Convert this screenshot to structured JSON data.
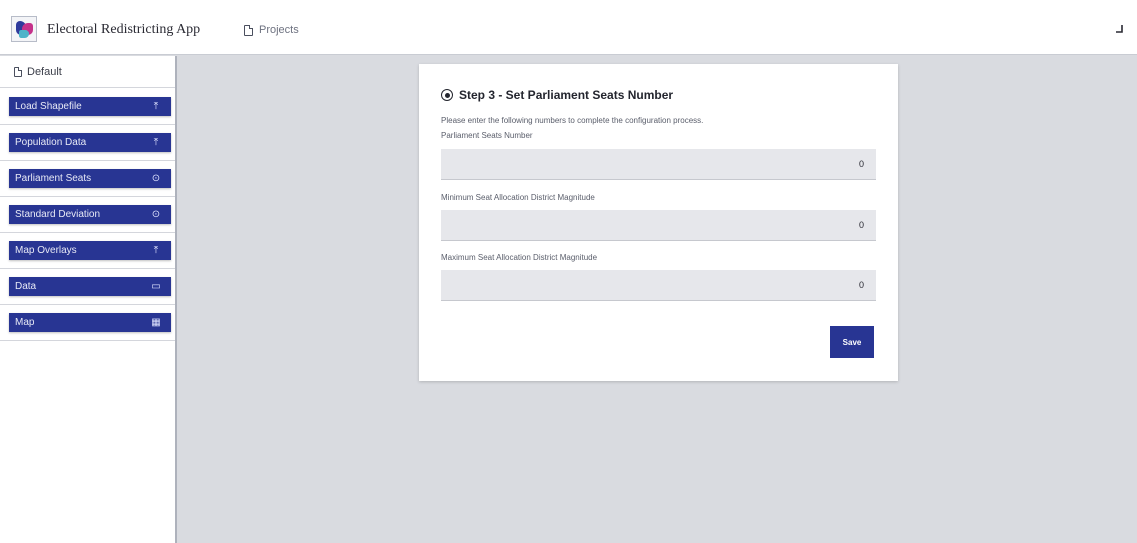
{
  "header": {
    "app_title": "Electoral Redistricting App",
    "projects_label": "Projects"
  },
  "sidebar": {
    "default_label": "Default",
    "items": [
      {
        "label": "Load Shapefile",
        "icon": "upload-icon"
      },
      {
        "label": "Population Data",
        "icon": "upload-icon"
      },
      {
        "label": "Parliament Seats",
        "icon": "radio-icon"
      },
      {
        "label": "Standard Deviation",
        "icon": "radio-icon"
      },
      {
        "label": "Map Overlays",
        "icon": "upload-icon"
      },
      {
        "label": "Data",
        "icon": "folder-icon"
      },
      {
        "label": "Map",
        "icon": "map-icon"
      }
    ]
  },
  "card": {
    "title": "Step 3 - Set Parliament Seats Number",
    "instructions": "Please enter the following numbers to complete the configuration process.",
    "fields": [
      {
        "label": "Parliament Seats Number",
        "value": "0"
      },
      {
        "label": "Minimum Seat Allocation District Magnitude",
        "value": "0"
      },
      {
        "label": "Maximum Seat Allocation District Magnitude",
        "value": "0"
      }
    ],
    "save_label": "Save"
  },
  "colors": {
    "accent": "#283593",
    "background": "#d9dbe0",
    "field_bg": "#e6e7eb"
  }
}
